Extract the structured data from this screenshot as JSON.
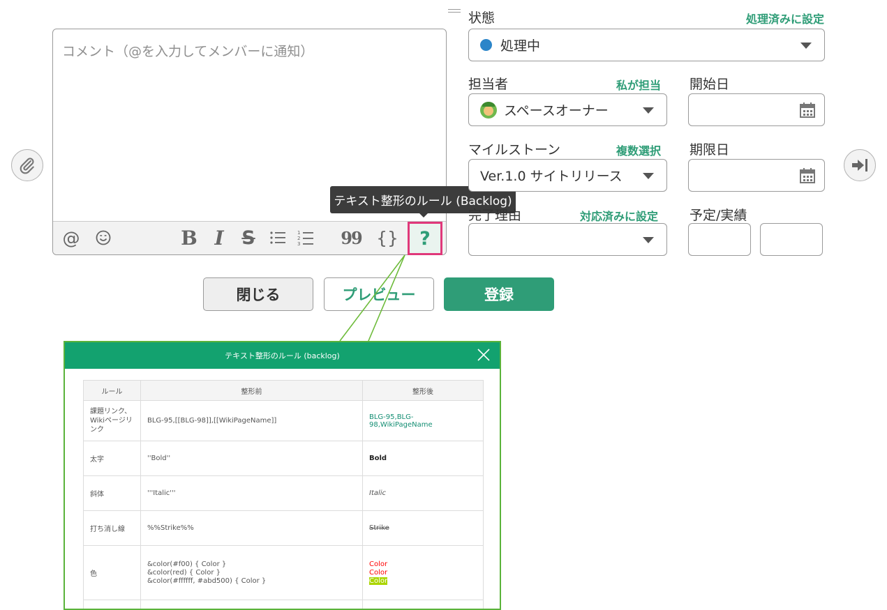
{
  "comment": {
    "placeholder": "コメント（@を入力してメンバーに通知）",
    "toolbar": {
      "mention": "@",
      "bold": "B",
      "italic": "I",
      "strike": "S",
      "quote": "99",
      "code": "{}",
      "help": "?"
    },
    "tooltip": "テキスト整形のルール (Backlog)"
  },
  "panel": {
    "status_label": "状態",
    "status_action": "処理済みに設定",
    "status_value": "処理中",
    "status_color": "#2b85c9",
    "assignee_label": "担当者",
    "assignee_action": "私が担当",
    "assignee_value": "スペースオーナー",
    "start_label": "開始日",
    "milestone_label": "マイルストーン",
    "milestone_action": "複数選択",
    "milestone_value": "Ver.1.0 サイトリリース",
    "due_label": "期限日",
    "resolution_label": "完了理由",
    "resolution_action": "対応済みに設定",
    "plan_label": "予定/実績"
  },
  "buttons": {
    "close": "閉じる",
    "preview": "プレビュー",
    "register": "登録"
  },
  "dialog": {
    "title": "テキスト整形のルール (backlog)",
    "headers": [
      "ルール",
      "整形前",
      "整形後"
    ],
    "rows": [
      {
        "rule": [
          "課題リンク、",
          "Wikiページリ",
          "ンク"
        ],
        "before": [
          "BLG-95,[[BLG-98]],[[WikiPageName]]"
        ],
        "after": [
          "BLG-95,BLG-98,WikiPageName"
        ]
      },
      {
        "rule": [
          "太字"
        ],
        "before": [
          "''Bold''"
        ],
        "after": [
          "Bold"
        ]
      },
      {
        "rule": [
          "斜体"
        ],
        "before": [
          "'''Italic'''"
        ],
        "after": [
          "Italic"
        ]
      },
      {
        "rule": [
          "打ち消し線"
        ],
        "before": [
          "%%Strike%%"
        ],
        "after": [
          "Strike"
        ]
      },
      {
        "rule": [
          "色"
        ],
        "before": [
          "&color(#f00) { Color }",
          "&color(red) { Color }",
          "&color(#ffffff, #abd500) { Color }"
        ],
        "after": [
          "Color",
          "Color",
          "Color"
        ]
      }
    ]
  },
  "colors": {
    "accent": "#2f9d77",
    "highlight": "#e0387a",
    "dialog_header": "#13a26f",
    "link": "#138e73",
    "red": "#ff0000",
    "lime": "#abd500"
  },
  "icons": {
    "attach": "paperclip-icon",
    "emoji": "smiley-icon",
    "bullet_list": "bullet-list-icon",
    "numbered_list": "numbered-list-icon",
    "calendar": "calendar-icon",
    "expand": "arrow-to-right-icon",
    "dialog_close": "close-icon",
    "drag": "drag-handle-icon"
  }
}
